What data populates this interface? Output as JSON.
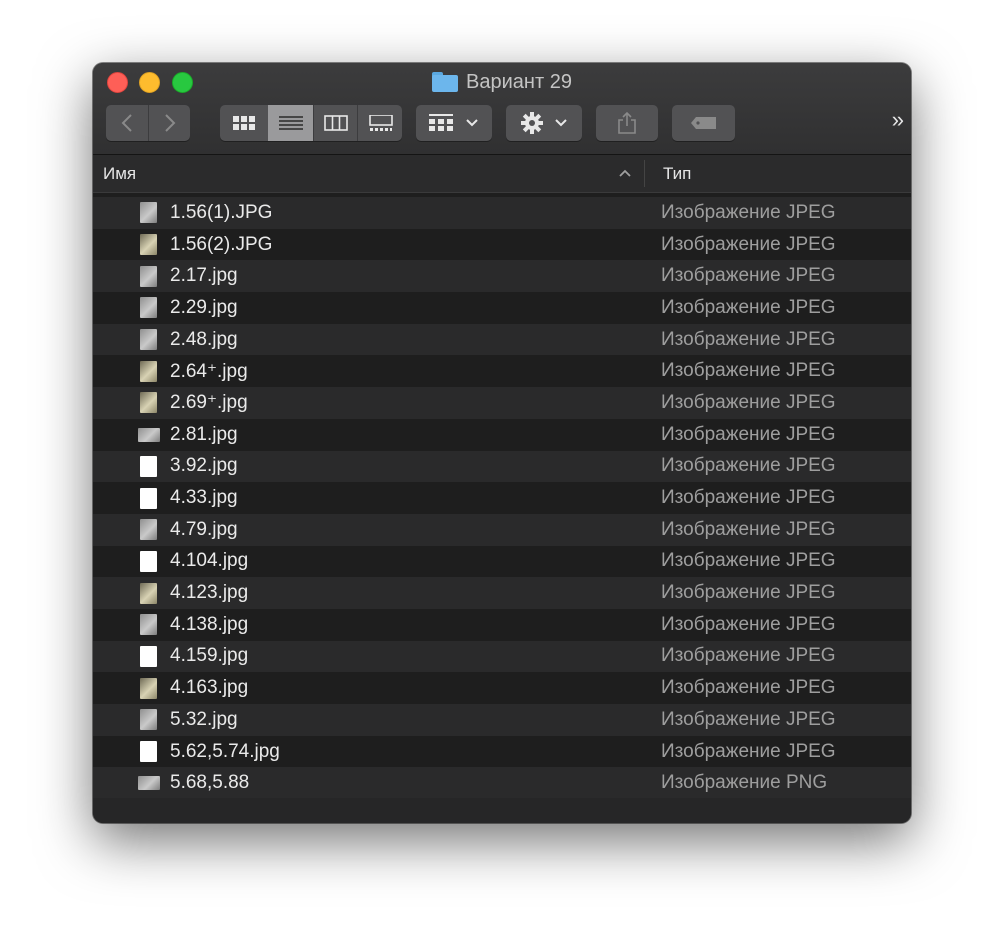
{
  "window": {
    "title": "Вариант 29"
  },
  "toolbar": {
    "more": "»"
  },
  "columns": {
    "name": "Имя",
    "type": "Тип",
    "sort_indicator": "^"
  },
  "icons": {
    "back": "chevron-left-icon",
    "forward": "chevron-right-icon",
    "view_icons": "grid-icon",
    "view_list": "list-icon",
    "view_columns": "columns-icon",
    "view_gallery": "gallery-icon",
    "group": "group-icon",
    "action": "gear-icon",
    "share": "share-icon",
    "tag": "tag-icon"
  },
  "files": [
    {
      "name": "1.56(1).JPG",
      "type": "Изображение JPEG",
      "thumb": "grey"
    },
    {
      "name": "1.56(2).JPG",
      "type": "Изображение JPEG",
      "thumb": "warm"
    },
    {
      "name": "2.17.jpg",
      "type": "Изображение JPEG",
      "thumb": "grey"
    },
    {
      "name": "2.29.jpg",
      "type": "Изображение JPEG",
      "thumb": "grey"
    },
    {
      "name": "2.48.jpg",
      "type": "Изображение JPEG",
      "thumb": "grey"
    },
    {
      "name": "2.64⁺.jpg",
      "type": "Изображение JPEG",
      "thumb": "warm"
    },
    {
      "name": "2.69⁺.jpg",
      "type": "Изображение JPEG",
      "thumb": "warm"
    },
    {
      "name": "2.81.jpg",
      "type": "Изображение JPEG",
      "thumb": "wide"
    },
    {
      "name": "3.92.jpg",
      "type": "Изображение JPEG",
      "thumb": "white"
    },
    {
      "name": "4.33.jpg",
      "type": "Изображение JPEG",
      "thumb": "white"
    },
    {
      "name": "4.79.jpg",
      "type": "Изображение JPEG",
      "thumb": "grey"
    },
    {
      "name": "4.104.jpg",
      "type": "Изображение JPEG",
      "thumb": "white"
    },
    {
      "name": "4.123.jpg",
      "type": "Изображение JPEG",
      "thumb": "warm"
    },
    {
      "name": "4.138.jpg",
      "type": "Изображение JPEG",
      "thumb": "grey"
    },
    {
      "name": "4.159.jpg",
      "type": "Изображение JPEG",
      "thumb": "white"
    },
    {
      "name": "4.163.jpg",
      "type": "Изображение JPEG",
      "thumb": "warm"
    },
    {
      "name": "5.32.jpg",
      "type": "Изображение JPEG",
      "thumb": "grey"
    },
    {
      "name": "5.62,5.74.jpg",
      "type": "Изображение JPEG",
      "thumb": "white"
    },
    {
      "name": "5.68,5.88",
      "type": "Изображение PNG",
      "thumb": "wide"
    }
  ]
}
